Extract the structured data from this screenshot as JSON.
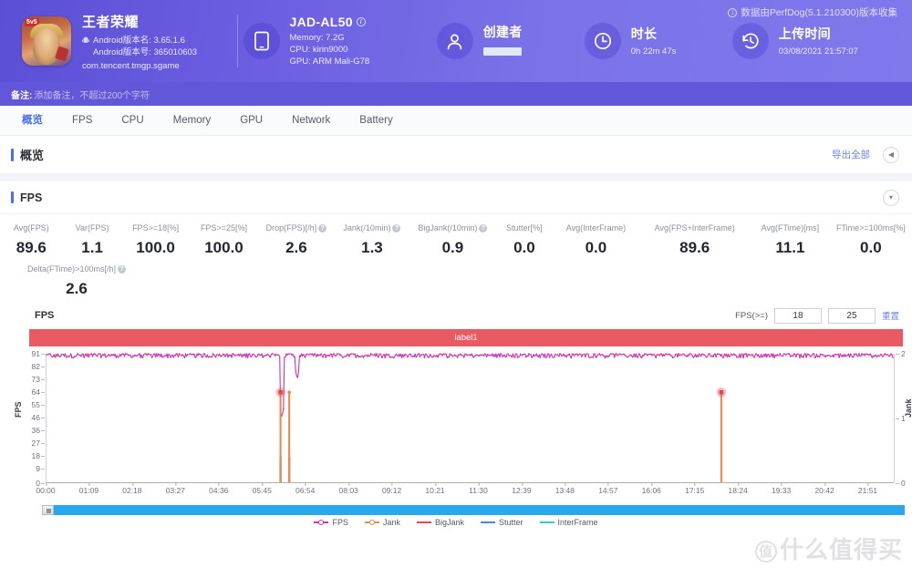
{
  "header": {
    "data_source_note": "数据由PerfDog(5.1.210300)版本收集",
    "app": {
      "name": "王者荣耀",
      "version_name_label": "Android版本名: 3.65.1.6",
      "version_code_label": "Android版本号: 365010603",
      "package": "com.tencent.tmgp.sgame",
      "icon": "game-app-icon"
    },
    "device": {
      "title": "JAD-AL50",
      "memory": "Memory: 7.2G",
      "cpu": "CPU: kirin9000",
      "gpu": "GPU: ARM Mali-G78",
      "icon": "phone-icon"
    },
    "creator": {
      "title": "创建者",
      "value": "",
      "icon": "user-icon"
    },
    "duration": {
      "title": "时长",
      "value": "0h 22m 47s",
      "icon": "clock-icon"
    },
    "upload": {
      "title": "上传时间",
      "value": "03/08/2021 21:57:07",
      "icon": "history-icon"
    }
  },
  "remark": {
    "label": "备注:",
    "placeholder": "添加备注，不超过200个字符"
  },
  "tabs": [
    {
      "label": "概览",
      "active": true
    },
    {
      "label": "FPS",
      "active": false
    },
    {
      "label": "CPU",
      "active": false
    },
    {
      "label": "Memory",
      "active": false
    },
    {
      "label": "GPU",
      "active": false
    },
    {
      "label": "Network",
      "active": false
    },
    {
      "label": "Battery",
      "active": false
    }
  ],
  "overview": {
    "title": "概览",
    "export_label": "导出全部",
    "collapse_icon": "chevron-left-icon"
  },
  "fps_card": {
    "title": "FPS",
    "collapse_icon": "chevron-down-icon",
    "metrics_row1": [
      {
        "label": "Avg(FPS)",
        "value": "89.6",
        "help": false
      },
      {
        "label": "Var(FPS)",
        "value": "1.1",
        "help": false
      },
      {
        "label": "FPS>=18[%]",
        "value": "100.0",
        "help": false
      },
      {
        "label": "FPS>=25[%]",
        "value": "100.0",
        "help": false
      },
      {
        "label": "Drop(FPS)[/h]",
        "value": "2.6",
        "help": true
      },
      {
        "label": "Jank(/10min)",
        "value": "1.3",
        "help": true
      },
      {
        "label": "BigJank(/10min)",
        "value": "0.9",
        "help": true
      },
      {
        "label": "Stutter[%]",
        "value": "0.0",
        "help": false
      },
      {
        "label": "Avg(InterFrame)",
        "value": "0.0",
        "help": false
      },
      {
        "label": "Avg(FPS+InterFrame)",
        "value": "89.6",
        "help": false
      },
      {
        "label": "Avg(FTime)[ms]",
        "value": "11.1",
        "help": false
      },
      {
        "label": "FTime>=100ms[%]",
        "value": "0.0",
        "help": false
      }
    ],
    "metrics_row2": [
      {
        "label": "Delta(FTime)>100ms[/h]",
        "value": "2.6",
        "help": true
      }
    ],
    "chart_controls": {
      "chart_name": "FPS",
      "fps_threshold_label": "FPS(>=)",
      "threshold_low": "18",
      "threshold_high": "25",
      "reset_label": "重置"
    },
    "label_bar": "label1"
  },
  "chart_data": {
    "type": "line",
    "title": "FPS",
    "xlabel": "",
    "ylabel": "FPS",
    "y2label": "Jank",
    "ylim": [
      0,
      91
    ],
    "y2lim": [
      0,
      2
    ],
    "grid": false,
    "legend_position": "bottom",
    "yticks": [
      0,
      9,
      18,
      27,
      36,
      46,
      55,
      64,
      73,
      82,
      91
    ],
    "y2ticks": [
      0,
      1,
      2
    ],
    "xticks": [
      "00:00",
      "01:09",
      "02:18",
      "03:27",
      "04:36",
      "05:45",
      "06:54",
      "08:03",
      "09:12",
      "10:21",
      "11:30",
      "12:39",
      "13:48",
      "14:57",
      "16:06",
      "17:15",
      "18:24",
      "19:33",
      "20:42",
      "21:51"
    ],
    "legend": [
      {
        "name": "FPS",
        "color": "#cc33aa",
        "style": "line-marker"
      },
      {
        "name": "Jank",
        "color": "#f08a4b",
        "style": "line-marker"
      },
      {
        "name": "BigJank",
        "color": "#e8474d",
        "style": "line"
      },
      {
        "name": "Stutter",
        "color": "#4a86e8",
        "style": "line"
      },
      {
        "name": "InterFrame",
        "color": "#33cccc",
        "style": "line"
      }
    ],
    "series": [
      {
        "name": "FPS",
        "color": "#cc33aa",
        "axis": "left",
        "description": "Dense oscillating trace held near 88-91 fps across the whole capture, with one deep dip to ~46 around 06:20 and a smaller dip to ~73 around 06:45.",
        "mean": 89.6,
        "min": 46,
        "max": 91,
        "dips": [
          {
            "time": "06:20",
            "value": 46
          },
          {
            "time": "06:45",
            "value": 73
          }
        ]
      },
      {
        "name": "Jank",
        "color": "#f08a4b",
        "axis": "right",
        "description": "Three impulse spikes reaching 1 jank each.",
        "spikes": [
          {
            "time": "06:18",
            "value": 1
          },
          {
            "time": "06:32",
            "value": 1
          },
          {
            "time": "18:10",
            "value": 1
          }
        ]
      },
      {
        "name": "BigJank",
        "color": "#e8474d",
        "axis": "right",
        "description": "Big jank markers at the top of two jank spikes.",
        "spikes": [
          {
            "time": "06:18",
            "value": 1
          },
          {
            "time": "18:10",
            "value": 1
          }
        ]
      },
      {
        "name": "Stutter",
        "color": "#4a86e8",
        "axis": "right",
        "description": "Short blue bases under the first two jank spikes.",
        "spikes": [
          {
            "time": "06:18",
            "value": 0.3
          },
          {
            "time": "06:32",
            "value": 0.3
          }
        ]
      },
      {
        "name": "InterFrame",
        "color": "#33cccc",
        "axis": "right",
        "description": "Flat at zero for the whole capture.",
        "spikes": []
      }
    ]
  },
  "watermark": "什么值得买"
}
